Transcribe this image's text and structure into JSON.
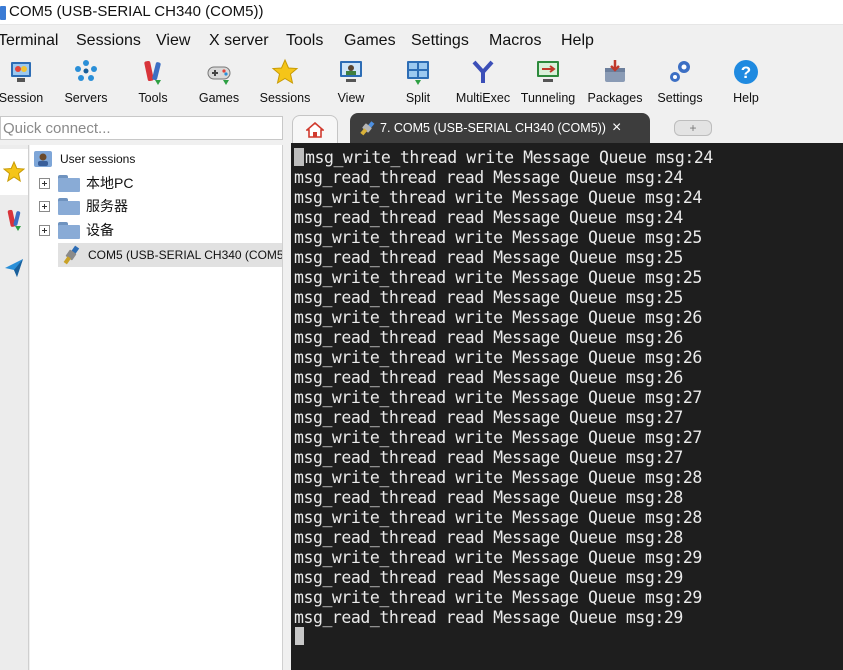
{
  "window": {
    "title": "COM5  (USB-SERIAL CH340 (COM5))"
  },
  "menu": [
    "Terminal",
    "Sessions",
    "View",
    "X server",
    "Tools",
    "Games",
    "Settings",
    "Macros",
    "Help"
  ],
  "toolbar": [
    {
      "label": "Session",
      "icon": "session-icon"
    },
    {
      "label": "Servers",
      "icon": "servers-icon"
    },
    {
      "label": "Tools",
      "icon": "tools-icon"
    },
    {
      "label": "Games",
      "icon": "games-icon"
    },
    {
      "label": "Sessions",
      "icon": "star-icon"
    },
    {
      "label": "View",
      "icon": "view-icon"
    },
    {
      "label": "Split",
      "icon": "split-icon"
    },
    {
      "label": "MultiExec",
      "icon": "multiexec-icon"
    },
    {
      "label": "Tunneling",
      "icon": "tunneling-icon"
    },
    {
      "label": "Packages",
      "icon": "packages-icon"
    },
    {
      "label": "Settings",
      "icon": "gears-icon"
    },
    {
      "label": "Help",
      "icon": "help-icon"
    }
  ],
  "quick_connect": {
    "placeholder": "Quick connect..."
  },
  "session_tree": {
    "root": "User sessions",
    "folders": [
      "本地PC",
      "服务器",
      "设备"
    ],
    "session": "COM5  (USB-SERIAL CH340 (COM5"
  },
  "tabs": {
    "active": {
      "label": "7. COM5  (USB-SERIAL CH340 (COM5))",
      "close": "×"
    },
    "new": "+"
  },
  "terminal": {
    "lines": [
      "msg_write_thread write Message Queue msg:24",
      "msg_read_thread read Message Queue msg:24",
      "msg_write_thread write Message Queue msg:24",
      "msg_read_thread read Message Queue msg:24",
      "msg_write_thread write Message Queue msg:25",
      "msg_read_thread read Message Queue msg:25",
      "msg_write_thread write Message Queue msg:25",
      "msg_read_thread read Message Queue msg:25",
      "msg_write_thread write Message Queue msg:26",
      "msg_read_thread read Message Queue msg:26",
      "msg_write_thread write Message Queue msg:26",
      "msg_read_thread read Message Queue msg:26",
      "msg_write_thread write Message Queue msg:27",
      "msg_read_thread read Message Queue msg:27",
      "msg_write_thread write Message Queue msg:27",
      "msg_read_thread read Message Queue msg:27",
      "msg_write_thread write Message Queue msg:28",
      "msg_read_thread read Message Queue msg:28",
      "msg_write_thread write Message Queue msg:28",
      "msg_read_thread read Message Queue msg:28",
      "msg_write_thread write Message Queue msg:29",
      "msg_read_thread read Message Queue msg:29",
      "msg_write_thread write Message Queue msg:29",
      "msg_read_thread read Message Queue msg:29"
    ]
  }
}
